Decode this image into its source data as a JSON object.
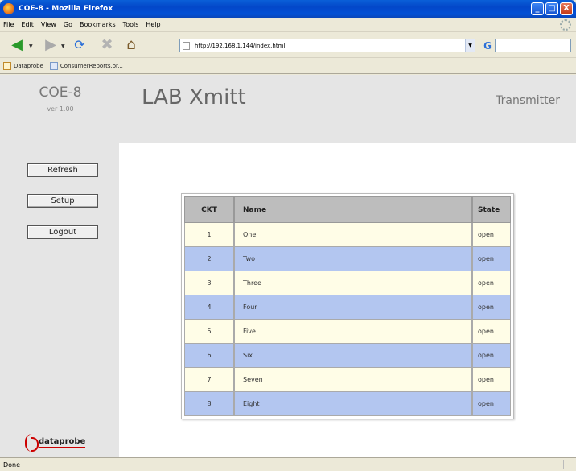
{
  "window": {
    "title": "COE-8 - Mozilla Firefox",
    "minimize": "_",
    "maximize": "□",
    "close": "X"
  },
  "menu": [
    "File",
    "Edit",
    "View",
    "Go",
    "Bookmarks",
    "Tools",
    "Help"
  ],
  "toolbar": {
    "url": "http://192.168.1.144/index.html",
    "icons": [
      "back-arrow-icon",
      "forward-arrow-icon",
      "reload-icon",
      "stop-icon",
      "home-icon",
      "go-icon"
    ]
  },
  "bookmarks": [
    "Dataprobe",
    "ConsumerReports.or..."
  ],
  "page": {
    "brand": "COE-8",
    "version": "ver 1.00",
    "heading": "LAB Xmitt",
    "subheading": "Transmitter",
    "buttons": {
      "refresh": "Refresh",
      "setup": "Setup",
      "logout": "Logout"
    },
    "logo_text": "dataprobe"
  },
  "table": {
    "headers": {
      "ckt": "CKT",
      "name": "Name",
      "state": "State"
    },
    "rows": [
      {
        "ckt": "1",
        "name": "One",
        "state": "open"
      },
      {
        "ckt": "2",
        "name": "Two",
        "state": "open"
      },
      {
        "ckt": "3",
        "name": "Three",
        "state": "open"
      },
      {
        "ckt": "4",
        "name": "Four",
        "state": "open"
      },
      {
        "ckt": "5",
        "name": "Five",
        "state": "open"
      },
      {
        "ckt": "6",
        "name": "Six",
        "state": "open"
      },
      {
        "ckt": "7",
        "name": "Seven",
        "state": "open"
      },
      {
        "ckt": "8",
        "name": "Eight",
        "state": "open"
      }
    ]
  },
  "status": "Done",
  "colors": {
    "row_odd": "#fffde7",
    "row_even": "#b3c6f0",
    "header_bg": "#e5e5e5"
  }
}
